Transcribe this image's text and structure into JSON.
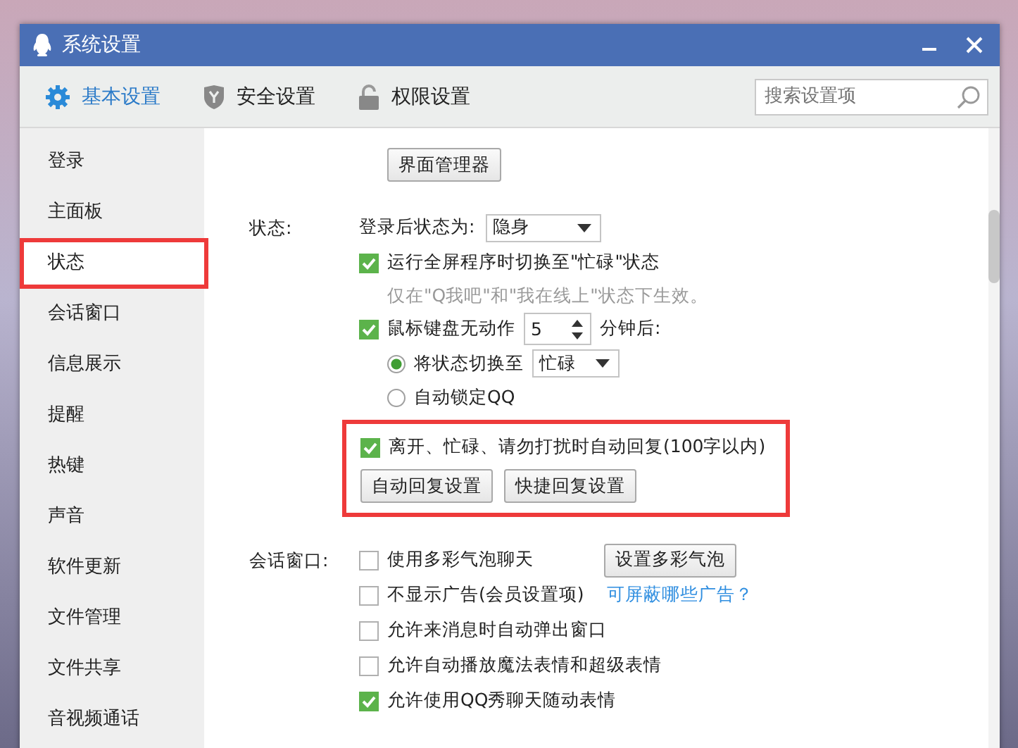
{
  "window": {
    "title": "系统设置"
  },
  "tabs": [
    {
      "label": "基本设置",
      "kind": "gear",
      "selected": true
    },
    {
      "label": "安全设置",
      "kind": "shield",
      "selected": false
    },
    {
      "label": "权限设置",
      "kind": "lock",
      "selected": false
    }
  ],
  "search": {
    "placeholder": "搜索设置项"
  },
  "sidebar": {
    "items": [
      {
        "label": "登录",
        "selected": false,
        "highlighted": false
      },
      {
        "label": "主面板",
        "selected": false,
        "highlighted": false
      },
      {
        "label": "状态",
        "selected": true,
        "highlighted": true
      },
      {
        "label": "会话窗口",
        "selected": false,
        "highlighted": false
      },
      {
        "label": "信息展示",
        "selected": false,
        "highlighted": false
      },
      {
        "label": "提醒",
        "selected": false,
        "highlighted": false
      },
      {
        "label": "热键",
        "selected": false,
        "highlighted": false
      },
      {
        "label": "声音",
        "selected": false,
        "highlighted": false
      },
      {
        "label": "软件更新",
        "selected": false,
        "highlighted": false
      },
      {
        "label": "文件管理",
        "selected": false,
        "highlighted": false
      },
      {
        "label": "文件共享",
        "selected": false,
        "highlighted": false
      },
      {
        "label": "音视频通话",
        "selected": false,
        "highlighted": false
      }
    ]
  },
  "content": {
    "top_button": "界面管理器",
    "sections": [
      {
        "label": "状态:",
        "rows": [
          {
            "kind": "dropdown",
            "label": "登录后状态为:",
            "value": "隐身"
          },
          {
            "kind": "checkbox",
            "label": "运行全屏程序时切换至\"忙碌\"状态",
            "checked": true
          },
          {
            "kind": "note",
            "label": "仅在\"Q我吧\"和\"我在线上\"状态下生效。"
          },
          {
            "kind": "spinner",
            "label": "鼠标键盘无动作",
            "checked": true,
            "value": "5",
            "suffix": "分钟后:",
            "radios": [
              {
                "label": "将状态切换至",
                "selected": true,
                "dropdown": "忙碌"
              },
              {
                "label": "自动锁定QQ",
                "selected": false
              }
            ]
          },
          {
            "kind": "group",
            "highlighted": true,
            "rows": [
              {
                "kind": "checkbox",
                "label": "离开、忙碌、请勿打扰时自动回复(100字以内)",
                "checked": true
              },
              {
                "kind": "buttons",
                "buttons": [
                  "自动回复设置",
                  "快捷回复设置"
                ]
              }
            ]
          }
        ]
      },
      {
        "label": "会话窗口:",
        "rows": [
          {
            "kind": "checkbox",
            "label": "使用多彩气泡聊天",
            "checked": false,
            "button": "设置多彩气泡"
          },
          {
            "kind": "checkbox",
            "label": "不显示广告(会员设置项)",
            "checked": false,
            "link": "可屏蔽哪些广告？"
          },
          {
            "kind": "checkbox",
            "label": "允许来消息时自动弹出窗口",
            "checked": false
          },
          {
            "kind": "checkbox",
            "label": "允许自动播放魔法表情和超级表情",
            "checked": false
          },
          {
            "kind": "checkbox",
            "label": "允许使用QQ秀聊天随动表情",
            "checked": true
          }
        ]
      }
    ]
  }
}
